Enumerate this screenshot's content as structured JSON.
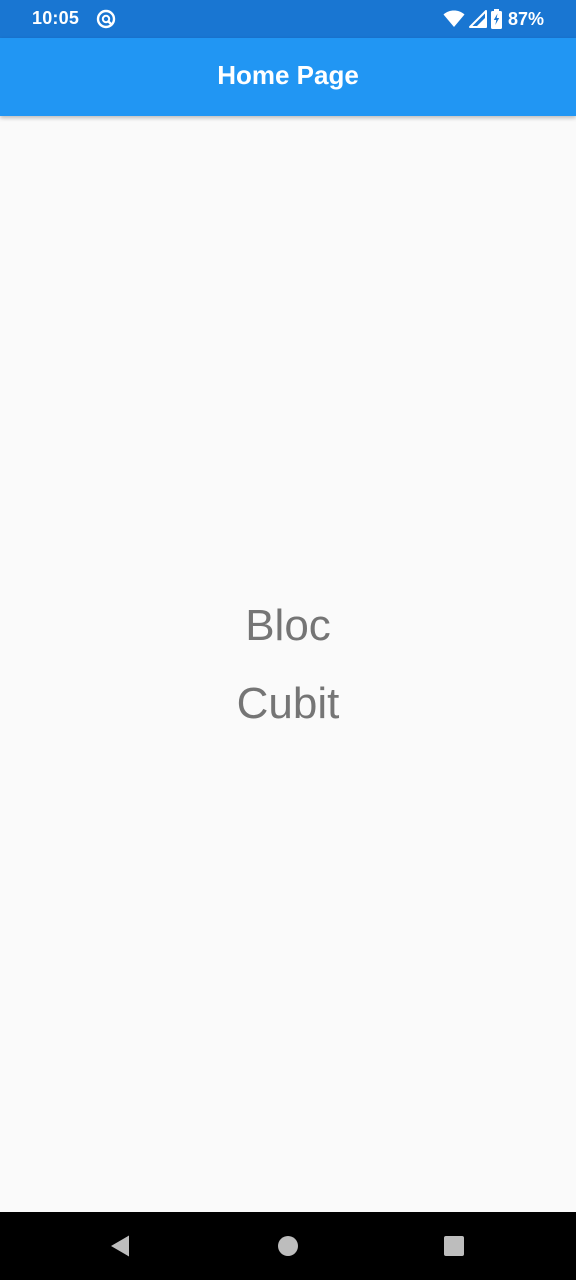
{
  "status_bar": {
    "time": "10:05",
    "battery_percent": "87%",
    "icons": [
      "app-notification-icon",
      "wifi-icon",
      "cellular-signal-icon",
      "battery-charging-icon"
    ]
  },
  "app_bar": {
    "title": "Home Page"
  },
  "content": {
    "line1": "Bloc",
    "line2": "Cubit"
  },
  "nav_bar": {
    "buttons": [
      "back-icon",
      "home-icon",
      "recents-icon"
    ]
  },
  "colors": {
    "status_bar": "#1976d2",
    "app_bar": "#2196f3",
    "background": "#fafafa",
    "body_text": "#757575",
    "nav_bar": "#000000"
  }
}
